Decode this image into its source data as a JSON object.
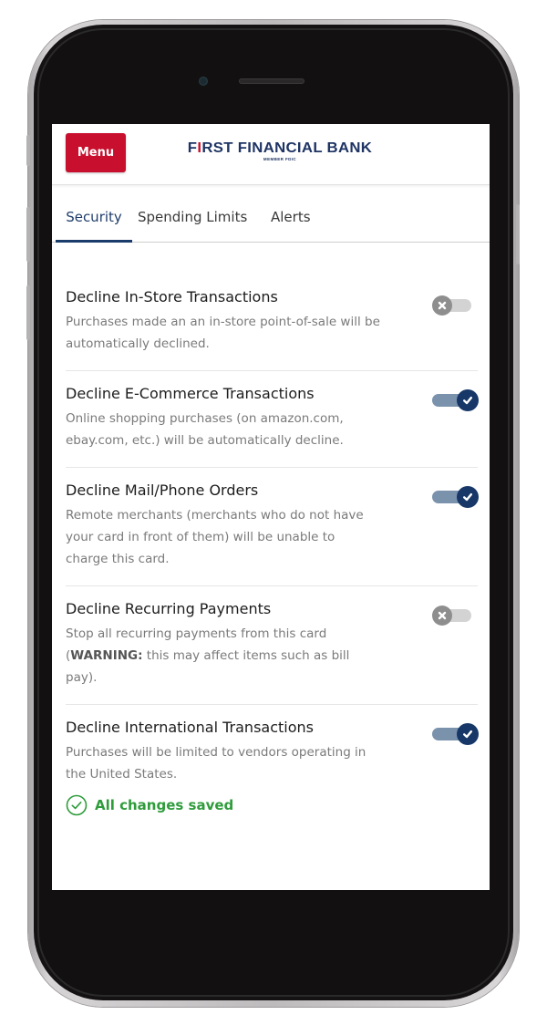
{
  "header": {
    "menu_label": "Menu",
    "logo": {
      "pre": "F",
      "accent": "I",
      "post": "RST FINANCIAL BANK",
      "subtitle": "MEMBER FDIC",
      "brand_color": "#1f3464",
      "accent_color": "#c8102e"
    },
    "menu_color": "#c8102e"
  },
  "tabs": [
    {
      "label": "Security",
      "active": true
    },
    {
      "label": "Spending Limits",
      "active": false
    },
    {
      "label": "Alerts",
      "active": false
    }
  ],
  "settings": [
    {
      "title": "Decline In-Store Transactions",
      "description": "Purchases made an an in-store point-of-sale will be automatically declined.",
      "enabled": false
    },
    {
      "title": "Decline E-Commerce Transactions",
      "description": "Online shopping purchases (on amazon.com, ebay.com, etc.) will be automatically decline.",
      "enabled": true
    },
    {
      "title": "Decline Mail/Phone Orders",
      "description": "Remote merchants (merchants who do not have your card in front of them) will be unable to charge this card.",
      "enabled": true
    },
    {
      "title": "Decline Recurring Payments",
      "description_pre": "Stop all recurring payments from this card (",
      "description_bold": "WARNING:",
      "description_post": " this may affect items such as bill pay).",
      "enabled": false
    },
    {
      "title": "Decline International Transactions",
      "description": "Purchases will be limited to vendors operating in the United States.",
      "enabled": true
    }
  ],
  "status": {
    "icon": "check-circle-icon",
    "text": "All changes saved",
    "color": "#2f9c3c"
  },
  "toggle_icons": {
    "on": "checkmark-icon",
    "off": "x-icon"
  }
}
